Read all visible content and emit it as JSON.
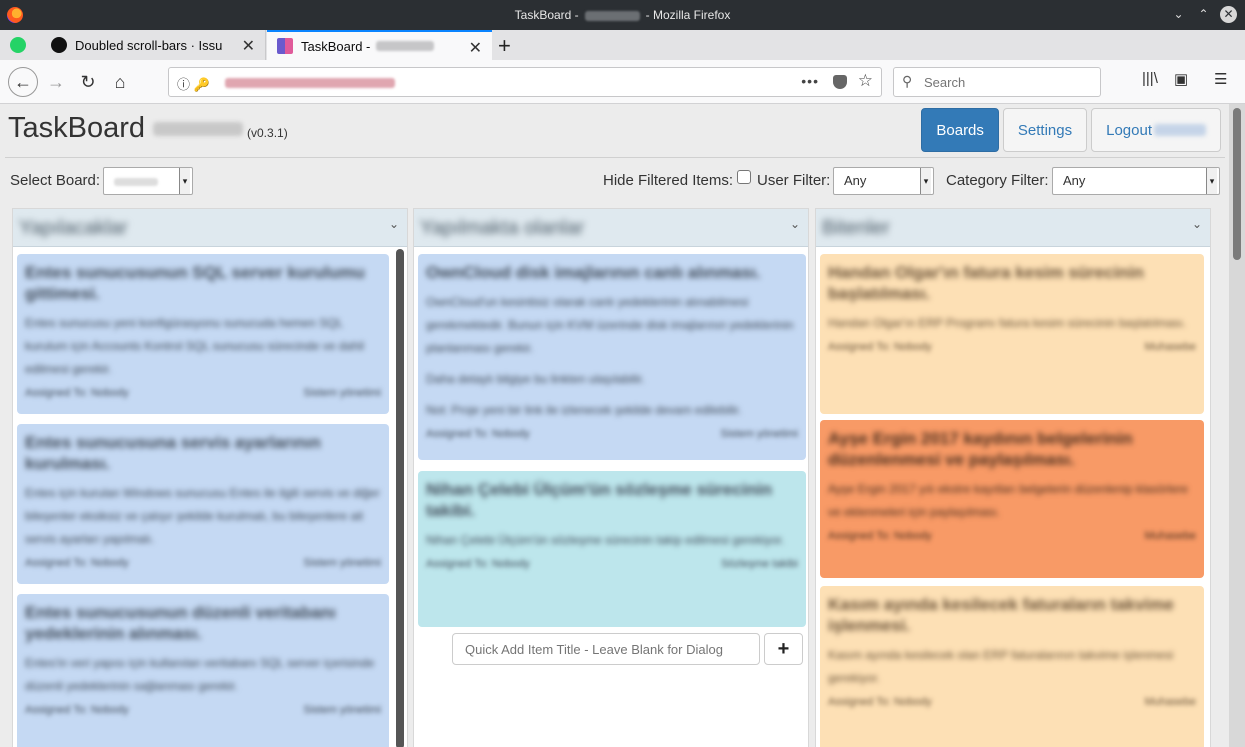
{
  "window": {
    "title_prefix": "TaskBoard -",
    "title_suffix": "- Mozilla Firefox"
  },
  "tabs": [
    {
      "label": "Doubled scroll-bars · Issu"
    },
    {
      "label": "TaskBoard -"
    }
  ],
  "search": {
    "placeholder": "Search"
  },
  "app": {
    "name": "TaskBoard",
    "version": "(v0.3.1)",
    "nav": {
      "boards": "Boards",
      "settings": "Settings",
      "logout": "Logout"
    }
  },
  "controls": {
    "select_board_label": "Select Board:",
    "hide_filtered_label": "Hide Filtered Items:",
    "user_filter_label": "User Filter:",
    "user_filter_value": "Any",
    "category_filter_label": "Category Filter:",
    "category_filter_value": "Any"
  },
  "columns": [
    {
      "name": "Yapılacaklar",
      "cards": [
        {
          "title": "Entes sunucusunun SQL server kurulumu gittimesi.",
          "desc": "Entes sunucusu yeni konfigürasyonu sunucuda hemen SQL kurulum için Accounts Kontrol SQL sunucusu sürecinde ve dahil edilmesi gerekir.",
          "assign": "Assigned To: Nobody",
          "date": "Sistem yönetimi"
        },
        {
          "title": "Entes sunucusuna servis ayarlarının kurulması.",
          "desc": "Entes için kurulan Windows sunucusu Entes ile ilgili servis ve diğer bileşenler eksiksiz ve çalışır şekilde kurulmalı, bu bileşenlere ait servis ayarları yapılmalı.",
          "assign": "Assigned To: Nobody",
          "date": "Sistem yönetimi"
        },
        {
          "title": "Entes sunucusunun düzenli veritabanı yedeklerinin alınması.",
          "desc": "Entes'in veri yapısı için kullanılan veritabanı SQL server içerisinde düzenli yedeklerinin sağlanması gerekir.",
          "assign": "Assigned To: Nobody",
          "date": "Sistem yönetimi"
        }
      ]
    },
    {
      "name": "Yapılmakta olanlar",
      "cards": [
        {
          "title": "OwnCloud disk imajlarının canlı alınması.",
          "desc": "OwnCloud'un kesintisiz olarak canlı yedeklerinin alınabilmesi gerekmektedir. Bunun için KVM üzerinde disk imajlarının yedeklerinin planlanması gerekir.",
          "extra1": "Daha detaylı bilgiye bu linkten ulaşılabilir.",
          "extra2": "Not: Proje yeni bir link ile izlenecek şekilde devam edilebilir.",
          "assign": "Assigned To: Nobody",
          "date": "Sistem yönetimi"
        },
        {
          "title": "Nihan Çelebi Ülçüm'ün sözleşme sürecinin takibi.",
          "desc": "Nihan Çelebi Ülçüm'ün sözleşme sürecinin takip edilmesi gerekiyor.",
          "assign": "Assigned To: Nobody",
          "date": "Sözleşme takibi"
        }
      ],
      "quick_add_placeholder": "Quick Add Item Title - Leave Blank for Dialog"
    },
    {
      "name": "Bitenler",
      "cards": [
        {
          "title": "Handan Olgar'ın fatura kesim sürecinin başlatılması.",
          "desc": "Handan Olgar'ın ERP Programı fatura kesim sürecinin başlatılması.",
          "assign": "Assigned To: Nobody",
          "date": "Muhasebe"
        },
        {
          "title": "Ayşe Ergin 2017 kaydının belgelerinin düzenlenmesi ve paylaşılması.",
          "desc": "Ayşe Ergin 2017 yılı ekstre kayıtları belgelerin düzenlenip klasörlere ve eklenmeleri için paylaşılması.",
          "assign": "Assigned To: Nobody",
          "date": "Muhasebe"
        },
        {
          "title": "Kasım ayında kesilecek faturaların takvime işlenmesi.",
          "desc": "Kasım ayında kesilecek olan ERP faturalarının takvime işlenmesi gerekiyor.",
          "assign": "Assigned To: Nobody",
          "date": "Muhasebe"
        }
      ]
    }
  ]
}
